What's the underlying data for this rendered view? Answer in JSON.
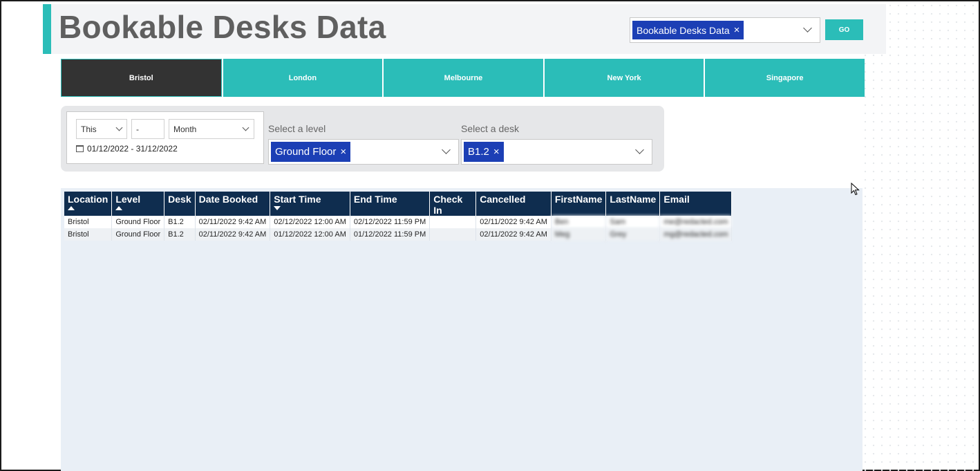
{
  "header": {
    "title": "Bookable Desks Data"
  },
  "report_picker": {
    "selected": "Bookable Desks Data",
    "remove": "×",
    "go_label": "GO"
  },
  "tabs": [
    {
      "label": "Bristol",
      "active": true
    },
    {
      "label": "London",
      "active": false
    },
    {
      "label": "Melbourne",
      "active": false
    },
    {
      "label": "New York",
      "active": false
    },
    {
      "label": "Singapore",
      "active": false
    }
  ],
  "date_filter": {
    "relative": "This",
    "count": "-",
    "unit": "Month",
    "range": "01/12/2022 - 31/12/2022"
  },
  "level_filter": {
    "label": "Select a level",
    "selected": "Ground Floor",
    "remove": "×"
  },
  "desk_filter": {
    "label": "Select a desk",
    "selected": "B1.2",
    "remove": "×"
  },
  "table": {
    "columns": [
      "Location",
      "Level",
      "Desk",
      "Date Booked",
      "Start Time",
      "End Time",
      "Check In",
      "Cancelled",
      "FirstName",
      "LastName",
      "Email"
    ],
    "rows": [
      [
        "Bristol",
        "Ground Floor",
        "B1.2",
        "02/11/2022 9:42 AM",
        "02/12/2022 12:00 AM",
        "02/12/2022 11:59 PM",
        "",
        "02/11/2022 9:42 AM",
        "Ben",
        "Sam",
        "me@redacted.com"
      ],
      [
        "Bristol",
        "Ground Floor",
        "B1.2",
        "02/11/2022 9:42 AM",
        "01/12/2022 12:00 AM",
        "01/12/2022 11:59 PM",
        "",
        "02/11/2022 9:42 AM",
        "Meg",
        "Grey",
        "mg@redacted.com"
      ]
    ]
  },
  "colors": {
    "accent": "#2bbdb8",
    "header_dark": "#0f2d4f",
    "chip_blue": "#1c3fb5",
    "active_tab": "#333333"
  }
}
